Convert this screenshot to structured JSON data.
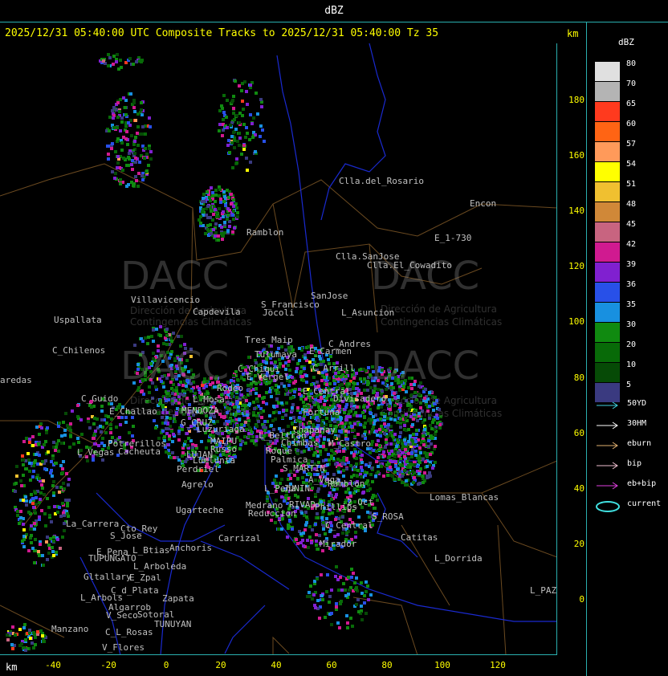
{
  "top_title": "dBZ",
  "header": "2025/12/31 05:40:00 UTC Composite Tracks to 2025/12/31 05:40:00 Tz 35",
  "unit_top": "km",
  "unit_bottom": "km",
  "y_ticks": [
    "180",
    "160",
    "140",
    "120",
    "100",
    "80",
    "60",
    "40",
    "20",
    "0"
  ],
  "x_ticks": [
    "-40",
    "-20",
    "0",
    "20",
    "40",
    "60",
    "80",
    "100",
    "120"
  ],
  "watermark": {
    "brand": "DACC",
    "line1": "Dirección de Agricultura",
    "line2": "Contingencias Climáticas"
  },
  "places": [
    {
      "id": "cllarosario",
      "label": "Clla.del_Rosario"
    },
    {
      "id": "encon",
      "label": "Encon"
    },
    {
      "id": "e1730",
      "label": "E_1-730"
    },
    {
      "id": "ramblon1",
      "label": "Ramblon"
    },
    {
      "id": "cllasanjose",
      "label": "Clla.SanJose"
    },
    {
      "id": "cllaelcowadito",
      "label": "Clla.El_Cowadito"
    },
    {
      "id": "villavicencio",
      "label": "Villavicencio"
    },
    {
      "id": "capdevila",
      "label": "Capdevila"
    },
    {
      "id": "sfrancisco",
      "label": "S_Francisco"
    },
    {
      "id": "sanjose",
      "label": "SanJose"
    },
    {
      "id": "lasuncion",
      "label": "L_Asuncion"
    },
    {
      "id": "uspallata",
      "label": "Uspallata"
    },
    {
      "id": "jocoli",
      "label": "Jocoli"
    },
    {
      "id": "tresmaip",
      "label": "Tres_Maip"
    },
    {
      "id": "candres",
      "label": "C_Andres"
    },
    {
      "id": "cchilenos",
      "label": "C_Chilenos"
    },
    {
      "id": "tulumaya",
      "label": "Tulumaya"
    },
    {
      "id": "ecarmen",
      "label": "E_Carmen"
    },
    {
      "id": "paredas",
      "label": "aredas"
    },
    {
      "id": "cchiqui",
      "label": "C_Chiqui"
    },
    {
      "id": "carrilli",
      "label": "C_Arrill"
    },
    {
      "id": "evergel",
      "label": "E_Vergel"
    },
    {
      "id": "rodeo",
      "label": "Rodeo"
    },
    {
      "id": "ecentral",
      "label": "E_Central"
    },
    {
      "id": "divisadero",
      "label": "Divisadero"
    },
    {
      "id": "cguido",
      "label": "C_Guido"
    },
    {
      "id": "lamosa",
      "label": "L_Mosa"
    },
    {
      "id": "ech",
      "label": "E_Challao"
    },
    {
      "id": "mendoza",
      "label": "MENDOZA"
    },
    {
      "id": "fortuna",
      "label": "Fortuna"
    },
    {
      "id": "gcruz",
      "label": "G_CRUZ"
    },
    {
      "id": "luzuriaga",
      "label": "Luzuriaga"
    },
    {
      "id": "lbeltran",
      "label": "L_Beltran"
    },
    {
      "id": "chapanay",
      "label": "Chapanay"
    },
    {
      "id": "maipu",
      "label": "MAIPU"
    },
    {
      "id": "russo",
      "label": "Russo"
    },
    {
      "id": "chimbas",
      "label": "Chimbas"
    },
    {
      "id": "mcastro",
      "label": "M_Castro"
    },
    {
      "id": "potrerillos",
      "label": "Potrerillos"
    },
    {
      "id": "cacheuta",
      "label": "Cacheuta"
    },
    {
      "id": "roque",
      "label": "Roque"
    },
    {
      "id": "lvegas",
      "label": "L_Vegas"
    },
    {
      "id": "lujan",
      "label": "LUJAN"
    },
    {
      "id": "lumlunta",
      "label": "Lumlunta"
    },
    {
      "id": "palmica",
      "label": "Palmica"
    },
    {
      "id": "smartin",
      "label": "S_MARTIN"
    },
    {
      "id": "perdriel",
      "label": "Perdriel"
    },
    {
      "id": "avega",
      "label": "A_Vega"
    },
    {
      "id": "ramblon2",
      "label": "Ramblon"
    },
    {
      "id": "agrelo",
      "label": "Agrelo"
    },
    {
      "id": "penajunin",
      "label": "L_Peña"
    },
    {
      "id": "junin",
      "label": "JUNIN"
    },
    {
      "id": "lomasblancas",
      "label": "Lomas_Blancas"
    },
    {
      "id": "oct",
      "label": "2_Oct"
    },
    {
      "id": "ugarteche",
      "label": "Ugarteche"
    },
    {
      "id": "medrano",
      "label": "Medrano"
    },
    {
      "id": "rivad",
      "label": "RIVAD"
    },
    {
      "id": "phillips",
      "label": "Phillips"
    },
    {
      "id": "reduccion",
      "label": "Reduccion"
    },
    {
      "id": "srosa",
      "label": "S_ROSA"
    },
    {
      "id": "lacarrera",
      "label": "La_Carrera"
    },
    {
      "id": "ctorey",
      "label": "Cto_Rey"
    },
    {
      "id": "cdelmar",
      "label": "C_Central"
    },
    {
      "id": "catitas",
      "label": "Catitas"
    },
    {
      "id": "sjose",
      "label": "S_Jose"
    },
    {
      "id": "carrizal",
      "label": "Carrizal"
    },
    {
      "id": "mirador",
      "label": "Mirador"
    },
    {
      "id": "epena",
      "label": "E_Pena"
    },
    {
      "id": "lbtias",
      "label": "L_Btias"
    },
    {
      "id": "anchoris",
      "label": "Anchoris"
    },
    {
      "id": "tupungato",
      "label": "TUPUNGATO"
    },
    {
      "id": "larboleda",
      "label": "L_Arboleda"
    },
    {
      "id": "ldorrida",
      "label": "L_Dorrida"
    },
    {
      "id": "gtallary",
      "label": "Gltallary"
    },
    {
      "id": "ezpal",
      "label": "E_Zpal"
    },
    {
      "id": "cdplata",
      "label": "C_d_Plata"
    },
    {
      "id": "zapata",
      "label": "Zapata"
    },
    {
      "id": "larbols",
      "label": "L_Arbols"
    },
    {
      "id": "lpaz",
      "label": "L_PAZ"
    },
    {
      "id": "algarrob",
      "label": "Algarrob"
    },
    {
      "id": "vseco",
      "label": "V_Seco"
    },
    {
      "id": "sotoral",
      "label": "Sotoral"
    },
    {
      "id": "tunuyan",
      "label": "TUNUYAN"
    },
    {
      "id": "manzano",
      "label": "Manzano"
    },
    {
      "id": "clrosas",
      "label": "C_L_Rosas"
    },
    {
      "id": "vflores",
      "label": "V_Flores"
    }
  ],
  "legend": {
    "title": "dBZ",
    "bins": [
      {
        "label": "80",
        "color": "#e0e0e0"
      },
      {
        "label": "70",
        "color": "#b4b4b4"
      },
      {
        "label": "65",
        "color": "#ff3a1e"
      },
      {
        "label": "60",
        "color": "#ff6414"
      },
      {
        "label": "57",
        "color": "#ff9a5a"
      },
      {
        "label": "54",
        "color": "#ffff00"
      },
      {
        "label": "51",
        "color": "#f0c030"
      },
      {
        "label": "48",
        "color": "#d08838"
      },
      {
        "label": "45",
        "color": "#c86480"
      },
      {
        "label": "42",
        "color": "#d01a90"
      },
      {
        "label": "39",
        "color": "#8020d0"
      },
      {
        "label": "36",
        "color": "#2850e8"
      },
      {
        "label": "35",
        "color": "#1890e0"
      },
      {
        "label": "30",
        "color": "#108a10"
      },
      {
        "label": "20",
        "color": "#086a08"
      },
      {
        "label": "10",
        "color": "#064a06"
      },
      {
        "label": "5",
        "color": "#3a3a80"
      }
    ],
    "tracks": [
      {
        "label": "50YD",
        "color": "#40d0e0"
      },
      {
        "label": "30HM",
        "color": "#ffffff"
      },
      {
        "label": "eburn",
        "color": "#e0b070"
      },
      {
        "label": "bip",
        "color": "#f0c0d0"
      },
      {
        "label": "eb+bip",
        "color": "#e040e0"
      },
      {
        "label": "current",
        "color": "#40e0e0"
      }
    ]
  }
}
